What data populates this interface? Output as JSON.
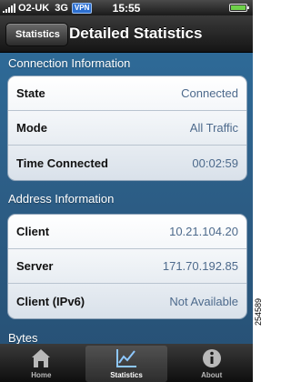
{
  "status_bar": {
    "carrier": "O2-UK",
    "network": "3G",
    "vpn": "VPN",
    "time": "15:55"
  },
  "nav": {
    "back_label": "Statistics",
    "title": "Detailed Statistics"
  },
  "connection": {
    "header": "Connection Information",
    "rows": [
      {
        "label": "State",
        "value": "Connected"
      },
      {
        "label": "Mode",
        "value": "All Traffic"
      },
      {
        "label": "Time Connected",
        "value": "00:02:59"
      }
    ]
  },
  "address": {
    "header": "Address Information",
    "rows": [
      {
        "label": "Client",
        "value": "10.21.104.20"
      },
      {
        "label": "Server",
        "value": "171.70.192.85"
      },
      {
        "label": "Client (IPv6)",
        "value": "Not Available"
      }
    ]
  },
  "bytes": {
    "header": "Bytes"
  },
  "tabs": [
    {
      "label": "Home",
      "icon": "home-icon"
    },
    {
      "label": "Statistics",
      "icon": "statistics-icon",
      "selected": true
    },
    {
      "label": "About",
      "icon": "info-icon"
    }
  ],
  "figure_ref": "254589",
  "colors": {
    "accent_value": "#4d6a8c",
    "background": "#2d5f88",
    "bar": "#151515"
  }
}
